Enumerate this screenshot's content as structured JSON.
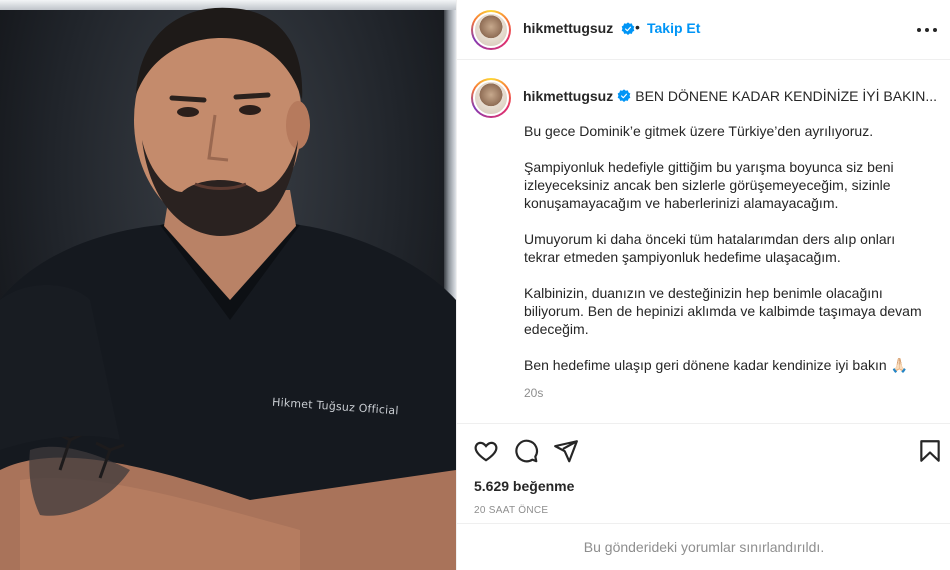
{
  "post": {
    "username": "hikmettugsuz",
    "follow_label": "Takip Et",
    "header_separator": "•",
    "shirt_print": "Hikmet Tuğsuz Official",
    "caption_first_line": "BEN DÖNENE KADAR KENDİNİZE İYİ BAKIN...",
    "caption_paragraphs": [
      "Bu gece Dominik’e gitmek üzere Türkiye’den ayrılıyoruz.",
      "Şampiyonluk hedefiyle gittiğim bu yarışma boyunca siz beni izleyeceksiniz ancak ben sizlerle görüşemeyeceğim, sizinle konuşamayacağım ve haberlerinizi alamayacağım.",
      "Umuyorum ki daha önceki tüm hatalarımdan ders alıp onları tekrar etmeden şampiyonluk hedefime ulaşacağım.",
      "Kalbinizin, duanızın ve desteğinizin hep benimle olacağını biliyorum. Ben de hepinizi aklımda ve kalbimde taşımaya devam edeceğim.",
      "Ben hedefime ulaşıp geri dönene kadar kendinize iyi bakın 🙏🏻"
    ],
    "caption_age": "20s",
    "likes": "5.629 beğenme",
    "posted_ago": "20 SAAT ÖNCE",
    "comments_limited": "Bu gönderideki yorumlar sınırlandırıldı."
  },
  "colors": {
    "accent": "#0095f6",
    "text": "#262626",
    "muted": "#8e8e8e",
    "border": "#efefef"
  },
  "icons": {
    "verified": "verified-badge-icon",
    "more": "more-horizontal-icon",
    "like": "heart-outline-icon",
    "comment": "comment-bubble-icon",
    "share": "paper-plane-icon",
    "save": "bookmark-outline-icon"
  }
}
